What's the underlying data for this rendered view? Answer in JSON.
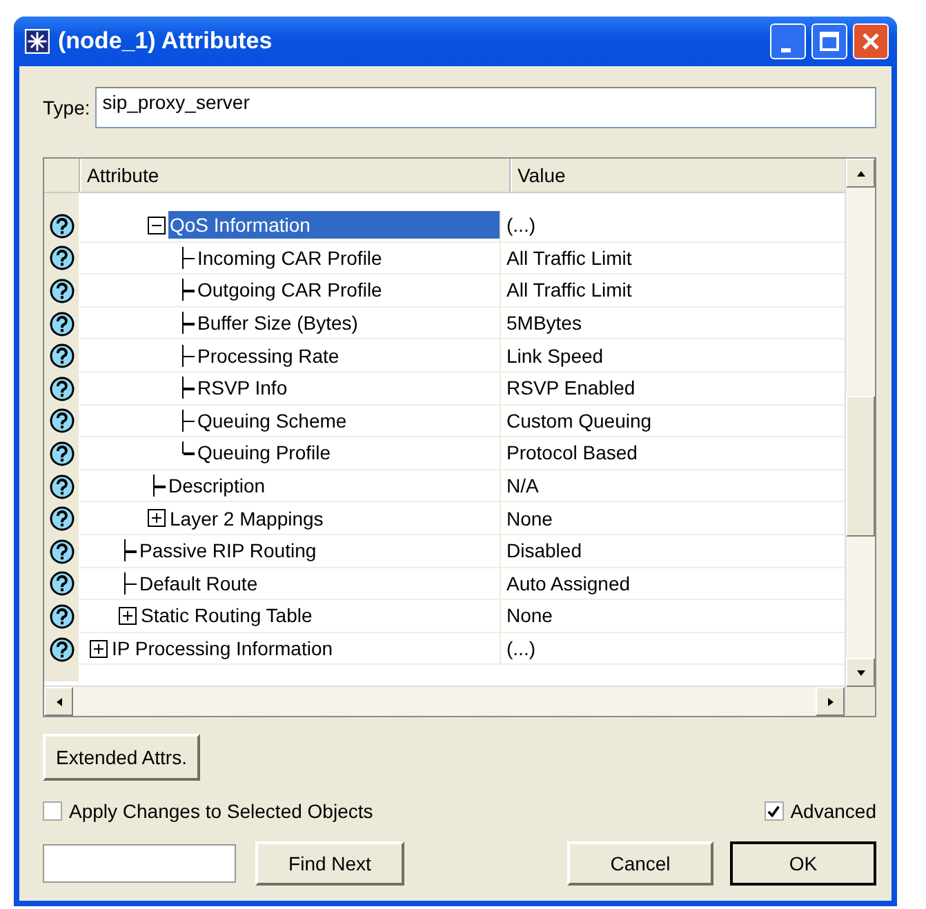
{
  "window": {
    "title": "(node_1) Attributes"
  },
  "type_field": {
    "label": "Type:",
    "value": "sip_proxy_server"
  },
  "table": {
    "columns": [
      "Attribute",
      "Value"
    ],
    "tree": [
      {
        "kind": "group",
        "children": [
          {
            "kind": "group",
            "children": [
              {
                "kind": "node",
                "label": "QoS Information",
                "value": "(...)",
                "selected": true,
                "expanded": true,
                "children": [
                  {
                    "kind": "leaf",
                    "label": "Incoming CAR Profile",
                    "value": "All Traffic Limit",
                    "selected": false
                  },
                  {
                    "kind": "leaf",
                    "label": "Outgoing CAR Profile",
                    "value": "All Traffic Limit",
                    "selected": false
                  },
                  {
                    "kind": "leaf",
                    "label": "Buffer Size (Bytes)",
                    "value": "5MBytes",
                    "selected": false
                  },
                  {
                    "kind": "leaf",
                    "label": "Processing Rate",
                    "value": "Link Speed",
                    "selected": false
                  },
                  {
                    "kind": "leaf",
                    "label": "RSVP Info",
                    "value": "RSVP Enabled",
                    "selected": false
                  },
                  {
                    "kind": "leaf",
                    "label": "Queuing Scheme",
                    "value": "Custom Queuing",
                    "selected": false
                  },
                  {
                    "kind": "leaf",
                    "label": "Queuing Profile",
                    "value": "Protocol Based",
                    "selected": false
                  }
                ]
              },
              {
                "kind": "leaf",
                "label": "Description",
                "value": "N/A",
                "selected": false
              },
              {
                "kind": "node",
                "label": "Layer 2 Mappings",
                "value": "None",
                "selected": false,
                "expanded": false
              }
            ]
          },
          {
            "kind": "leaf",
            "label": "Passive RIP Routing",
            "value": "Disabled",
            "selected": false
          },
          {
            "kind": "leaf",
            "label": "Default Route",
            "value": "Auto Assigned",
            "selected": false
          },
          {
            "kind": "node",
            "label": "Static Routing Table",
            "value": "None",
            "selected": false,
            "expanded": false
          }
        ]
      },
      {
        "kind": "node",
        "label": "IP Processing Information",
        "value": "(...)",
        "selected": false,
        "expanded": false
      }
    ]
  },
  "extended_button": "Extended Attrs.",
  "apply_changes": {
    "label": "Apply Changes to Selected Objects",
    "checked": false
  },
  "advanced": {
    "label": "Advanced",
    "checked": true
  },
  "buttons": [
    "Find Next",
    "Cancel",
    "OK"
  ]
}
